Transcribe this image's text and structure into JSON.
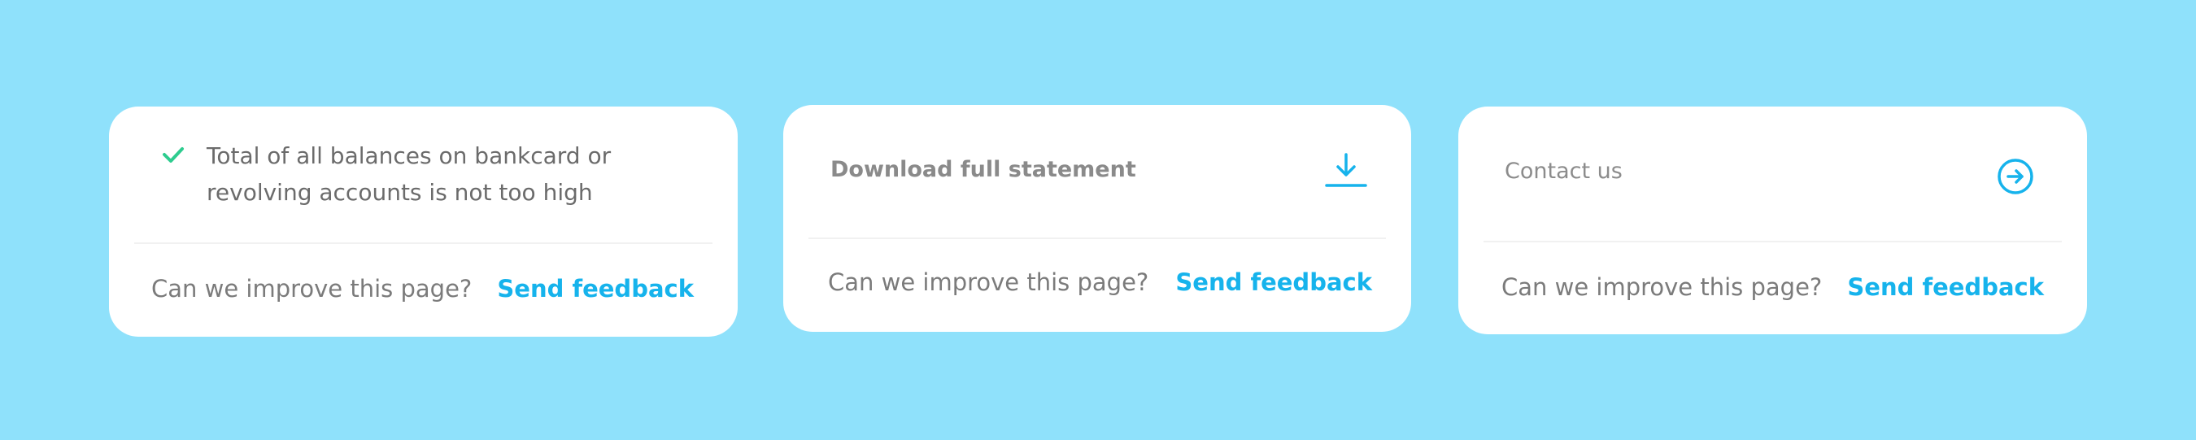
{
  "colors": {
    "background": "#8fe1fb",
    "card": "#ffffff",
    "accent": "#16b3ec",
    "check": "#2ecc8f",
    "text_muted": "#7b7b7b"
  },
  "cards": [
    {
      "check_icon": "checkmark-icon",
      "text_line_1": "Total of all balances on bankcard or",
      "text_line_2": "revolving accounts is not too high",
      "question": "Can we improve this page?",
      "feedback_label": "Send feedback"
    },
    {
      "label": "Download full statement",
      "icon": "download-icon",
      "question": "Can we improve this page?",
      "feedback_label": "Send feedback"
    },
    {
      "label": "Contact us",
      "icon": "arrow-right-circle-icon",
      "question": "Can we improve this page?",
      "feedback_label": "Send feedback"
    }
  ]
}
